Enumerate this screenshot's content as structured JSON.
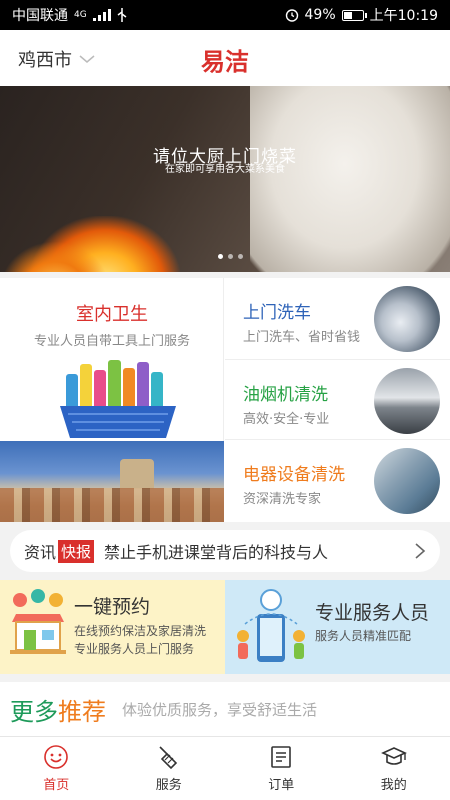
{
  "status_bar": {
    "carrier": "中国联通",
    "network": "4G",
    "battery": "49%",
    "battery_level": 0.49,
    "time": "上午10:19"
  },
  "header": {
    "city": "鸡西市",
    "title": "易洁"
  },
  "banner": {
    "title": "请位大厨上门烧菜",
    "subtitle": "在家即可享用各大菜系美食",
    "slide_count": 3,
    "active_slide": 0
  },
  "services": {
    "big_card": {
      "title": "室内卫生",
      "subtitle": "专业人员自带工具上门服务",
      "color": "#d9302c"
    },
    "rows": [
      {
        "title": "上门洗车",
        "subtitle": "上门洗车、省时省钱",
        "color": "#2e63b8"
      },
      {
        "title": "油烟机清洗",
        "subtitle": "高效·安全·专业",
        "color": "#27a245"
      },
      {
        "title": "电器设备清洗",
        "subtitle": "资深清洗专家",
        "color": "#ef7c1e"
      }
    ]
  },
  "news": {
    "label": "资讯",
    "tag": "快报",
    "headline": "禁止手机进课堂背后的科技与人"
  },
  "promos": [
    {
      "title": "一键预约",
      "lines": [
        "在线预约保洁及家居清洗",
        "专业服务人员上门服务"
      ]
    },
    {
      "title": "专业服务人员",
      "lines": [
        "服务人员精准匹配"
      ]
    }
  ],
  "recommend": {
    "title_part1": "更多",
    "title_part2": "推荐",
    "subtitle": "体验优质服务，享受舒适生活"
  },
  "bottom_nav": [
    {
      "label": "首页",
      "icon": "smile-icon",
      "active": true
    },
    {
      "label": "服务",
      "icon": "broom-icon",
      "active": false
    },
    {
      "label": "订单",
      "icon": "order-icon",
      "active": false
    },
    {
      "label": "我的",
      "icon": "graduation-cap-icon",
      "active": false
    }
  ],
  "colors": {
    "brand_red": "#d9302c",
    "green": "#1e9a5a",
    "orange": "#ef7c1e"
  }
}
